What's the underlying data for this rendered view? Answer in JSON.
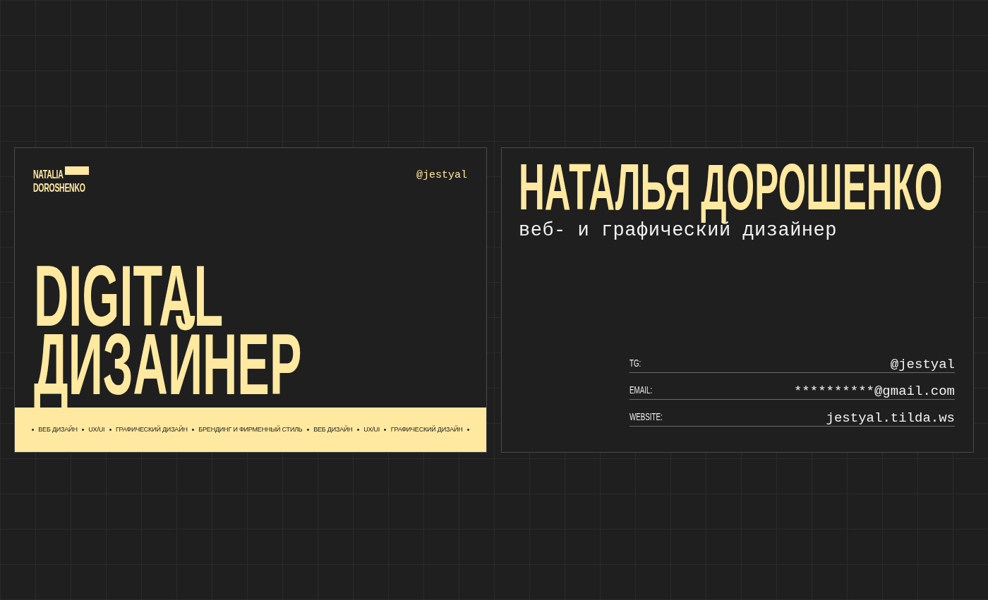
{
  "front": {
    "logo": {
      "line1": "NATALIA",
      "line2": "DOROSHENKO"
    },
    "handle": "@jestyal",
    "headline": [
      "DIGITAL",
      "ДИЗАЙНЕР"
    ],
    "services": [
      "ВЕБ ДИЗАЙН",
      "UX/UI",
      "ГРАФИЧЕСКИЙ ДИЗАЙН",
      "БРЕНДИНГ И ФИРМЕННЫЙ СТИЛЬ",
      "ВЕБ ДИЗАЙН",
      "UX/UI",
      "ГРАФИЧЕСКИЙ ДИЗАЙН"
    ]
  },
  "back": {
    "name": "НАТАЛЬЯ ДОРОШЕНКО",
    "role": "веб- и графический дизайнер",
    "contacts": [
      {
        "label": "TG:",
        "value": "@jestyal"
      },
      {
        "label": "EMAIL:",
        "value": "**********@gmail.com"
      },
      {
        "label": "WEBSITE:",
        "value": "jestyal.tilda.ws"
      }
    ]
  }
}
